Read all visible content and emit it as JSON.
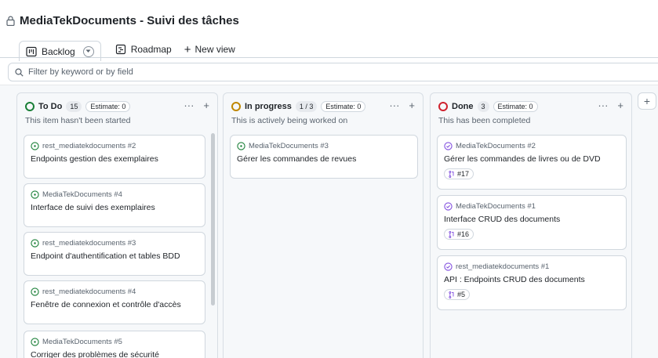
{
  "project": {
    "title": "MediaTekDocuments - Suivi des tâches"
  },
  "views": {
    "tabs": [
      {
        "label": "Backlog"
      },
      {
        "label": "Roadmap"
      }
    ],
    "new_view_label": "New view"
  },
  "filter": {
    "placeholder": "Filter by keyword or by field"
  },
  "columns": [
    {
      "name": "To Do",
      "count": "15",
      "estimate": "Estimate: 0",
      "description": "This item hasn't been started",
      "status_color": "#1a7f37",
      "cards": [
        {
          "repo": "rest_mediatekdocuments #2",
          "title": "Endpoints gestion des exemplaires"
        },
        {
          "repo": "MediaTekDocuments #4",
          "title": "Interface de suivi des exemplaires"
        },
        {
          "repo": "rest_mediatekdocuments #3",
          "title": "Endpoint d'authentification et tables BDD"
        },
        {
          "repo": "rest_mediatekdocuments #4",
          "title": "Fenêtre de connexion et contrôle d'accès"
        },
        {
          "repo": "MediaTekDocuments #5",
          "title": "Corriger des problèmes de sécurité"
        }
      ]
    },
    {
      "name": "In progress",
      "count": "1 / 3",
      "estimate": "Estimate: 0",
      "description": "This is actively being worked on",
      "status_color": "#bf8700",
      "cards": [
        {
          "repo": "MediaTekDocuments #3",
          "title": "Gérer les commandes de revues"
        }
      ]
    },
    {
      "name": "Done",
      "count": "3",
      "estimate": "Estimate: 0",
      "description": "This has been completed",
      "status_color": "#cf222e",
      "cards": [
        {
          "repo": "MediaTekDocuments #2",
          "title": "Gérer les commandes de livres ou de DVD",
          "pr": "#17"
        },
        {
          "repo": "MediaTekDocuments #1",
          "title": "Interface CRUD des documents",
          "pr": "#16"
        },
        {
          "repo": "rest_mediatekdocuments #1",
          "title": "API : Endpoints CRUD des documents",
          "pr": "#5"
        }
      ]
    }
  ],
  "colors": {
    "open": "#1a7f37",
    "closed": "#8250df",
    "border": "#d0d7de"
  },
  "icons": [
    "lock-icon",
    "board-icon",
    "roadmap-icon",
    "plus-icon",
    "search-icon",
    "issue-open-icon",
    "issue-closed-icon",
    "pull-request-icon",
    "kebab-icon"
  ]
}
